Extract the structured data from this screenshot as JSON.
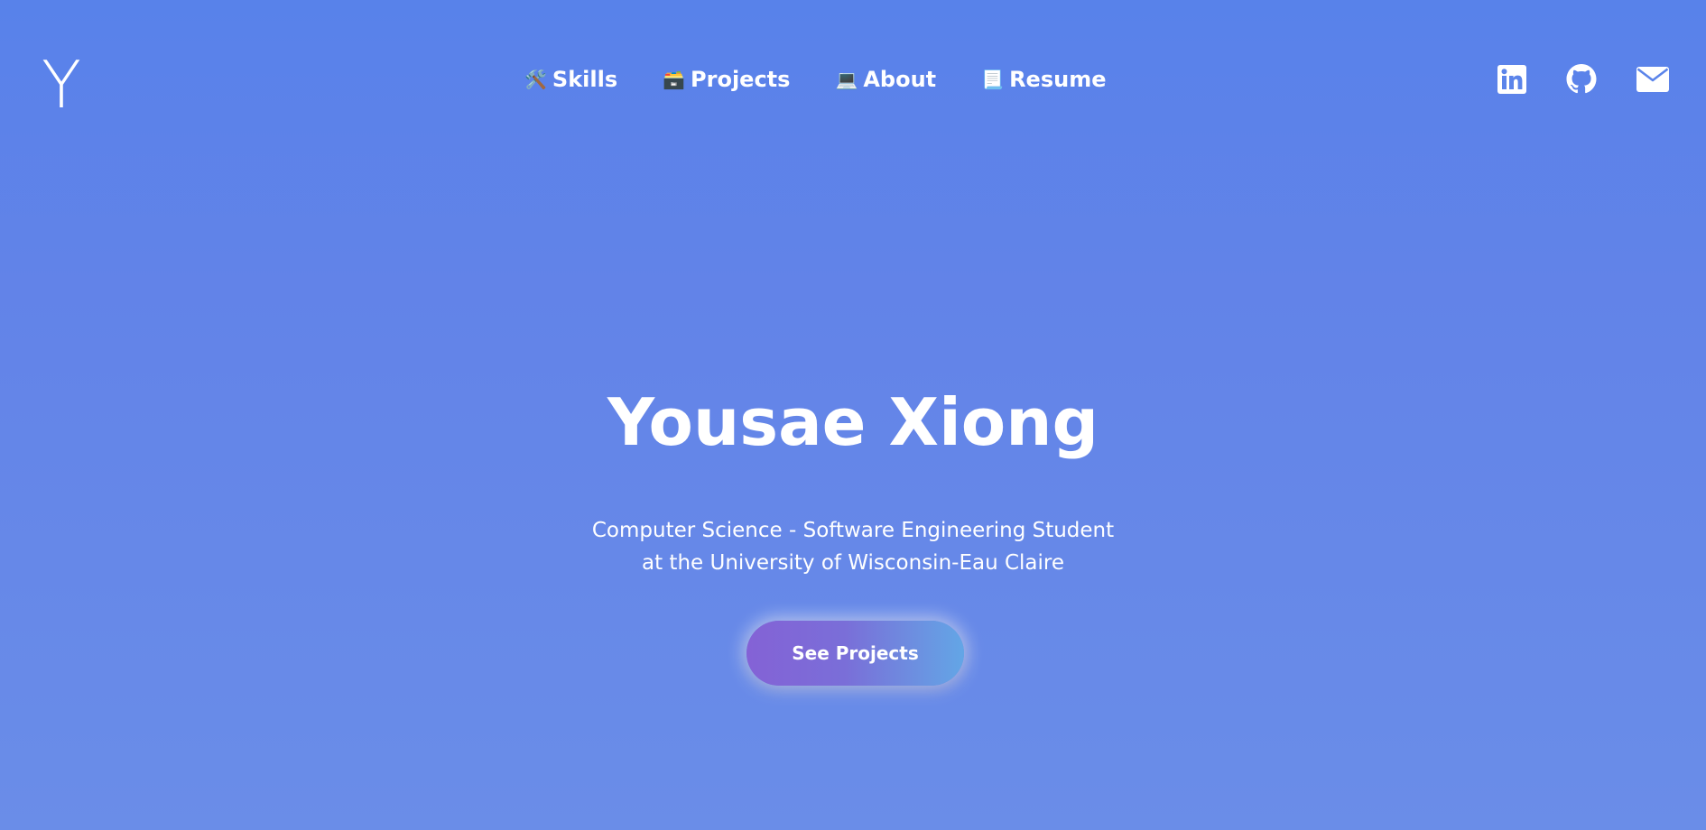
{
  "header": {
    "logo_text": "Y",
    "nav": [
      {
        "icon": "🛠️",
        "icon_name": "hammer-wrench-icon",
        "label": "Skills"
      },
      {
        "icon": "🗃️",
        "icon_name": "card-file-box-icon",
        "label": "Projects"
      },
      {
        "icon": "💻",
        "icon_name": "laptop-icon",
        "label": "About"
      },
      {
        "icon": "📃",
        "icon_name": "page-curl-icon",
        "label": "Resume"
      }
    ],
    "social": [
      {
        "icon_name": "linkedin-icon"
      },
      {
        "icon_name": "github-icon"
      },
      {
        "icon_name": "envelope-icon"
      }
    ]
  },
  "hero": {
    "title": "Yousae Xiong",
    "subtitle": "Computer Science - Software Engineering Student at the University of Wisconsin-Eau Claire",
    "cta_label": "See Projects"
  },
  "colors": {
    "background_top": "#5882ea",
    "background_bottom": "#6a8de8",
    "text": "#ffffff",
    "button_gradient_start": "#8462d6",
    "button_gradient_end": "#63a6e6"
  }
}
